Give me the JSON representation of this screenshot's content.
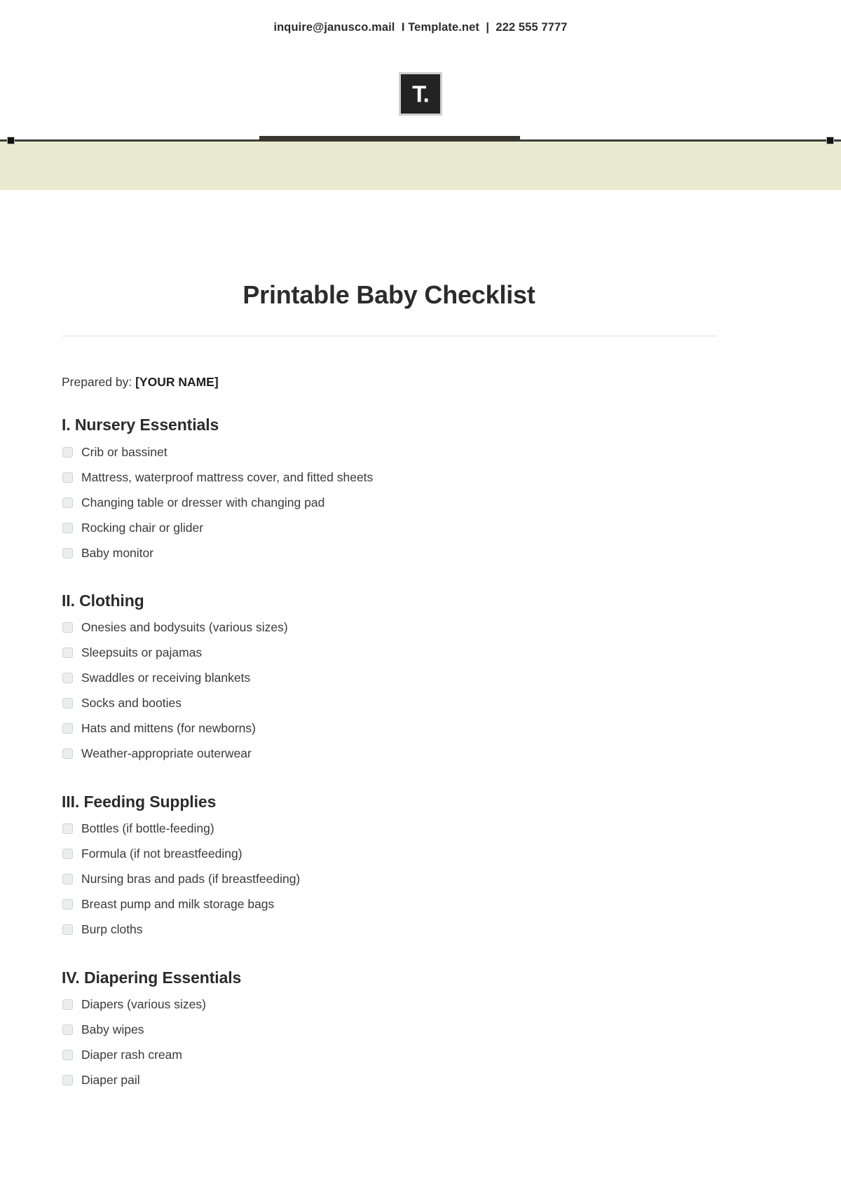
{
  "letterhead": {
    "logo_text": "T.",
    "logo_icon": "template-net-logo-icon",
    "contact_line": "inquire@janusco.mail  I Template.net  |  222 555 7777",
    "band_color": "#e8e9cf",
    "rule_color": "#3c3c38"
  },
  "document": {
    "title": "Printable Baby Checklist",
    "prepared_by_label": "Prepared by:",
    "prepared_by_value": "[YOUR NAME]",
    "sections": [
      {
        "heading": "I. Nursery Essentials",
        "items": [
          "Crib or bassinet",
          "Mattress, waterproof mattress cover, and fitted sheets",
          "Changing table or dresser with changing pad",
          "Rocking chair or glider",
          "Baby monitor"
        ]
      },
      {
        "heading": "II. Clothing",
        "items": [
          "Onesies and bodysuits (various sizes)",
          "Sleepsuits or pajamas",
          "Swaddles or receiving blankets",
          "Socks and booties",
          "Hats and mittens (for newborns)",
          "Weather-appropriate outerwear"
        ]
      },
      {
        "heading": "III. Feeding Supplies",
        "items": [
          "Bottles (if bottle-feeding)",
          "Formula (if not breastfeeding)",
          "Nursing bras and pads (if breastfeeding)",
          "Breast pump and milk storage bags",
          "Burp cloths"
        ]
      },
      {
        "heading": "IV. Diapering Essentials",
        "items": [
          "Diapers (various sizes)",
          "Baby wipes",
          "Diaper rash cream",
          "Diaper pail"
        ]
      }
    ]
  }
}
